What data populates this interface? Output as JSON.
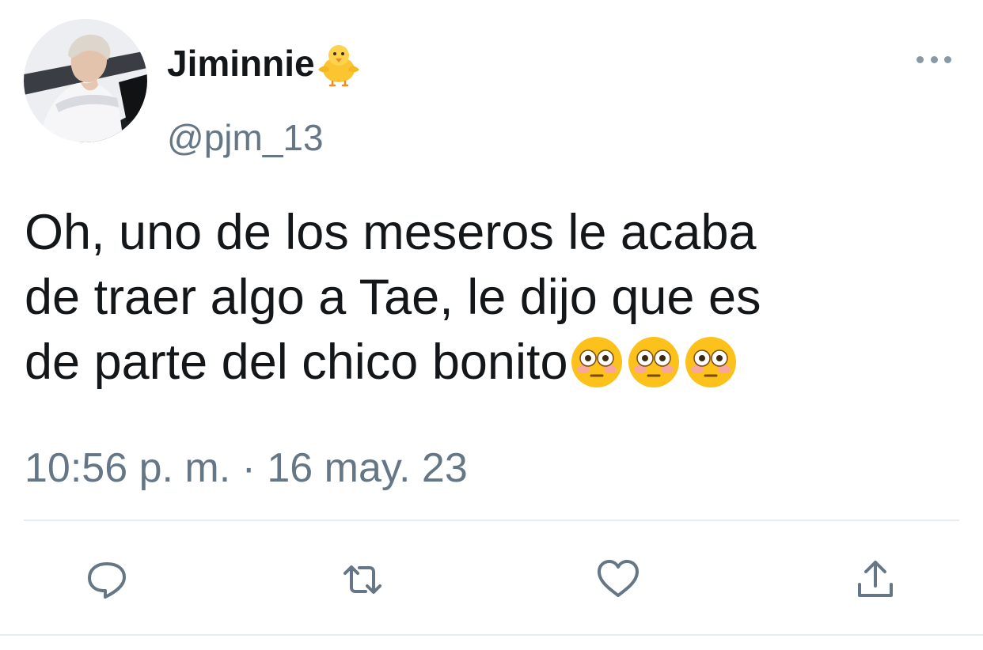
{
  "tweet": {
    "display_name": "Jiminnie",
    "name_emoji": "baby-chick-icon",
    "handle": "@pjm_13",
    "text_lines": [
      "Oh, uno de los meseros le acaba",
      "de traer algo a Tae, le dijo que es",
      "de parte del chico bonito"
    ],
    "text_emoji": [
      "flushed-face-icon",
      "flushed-face-icon",
      "flushed-face-icon"
    ],
    "timestamp": "10:56 p. m. · 16 may. 23"
  },
  "actions": [
    "reply-icon",
    "retweet-icon",
    "like-icon",
    "share-icon"
  ],
  "colors": {
    "text": "#14171a",
    "secondary": "#657786",
    "icon": "#657786",
    "divider": "#e6ecf0"
  }
}
